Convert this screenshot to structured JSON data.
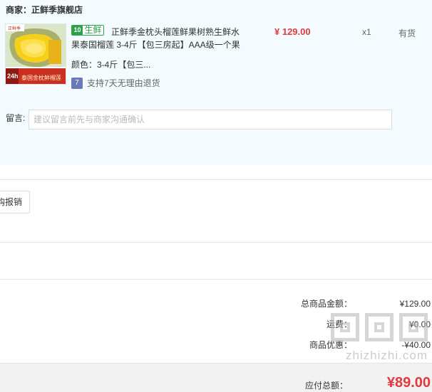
{
  "shop": {
    "label": "商家：",
    "name": "正鲜季旗舰店"
  },
  "product": {
    "fresh_tag": {
      "icon": "store-fresh-icon",
      "text": "生鲜",
      "color": "#2ca34a"
    },
    "title": "正鲜季金枕头榴莲鲜果树熟生鲜水果泰国榴莲 3-4斤【包三房起】AAA级一个果",
    "image_caption": "泰国金枕鲜榴莲",
    "image_badge": "24h",
    "price": "¥ 129.00",
    "quantity": "x1",
    "stock": "有货",
    "color_label": "颜色：",
    "color_value": "3-4斤【包三...",
    "return_badge": "7",
    "return_policy": "支持7天无理由退货"
  },
  "remark": {
    "label": "留言:",
    "placeholder": "建议留言前先与商家沟通确认"
  },
  "invoice": {
    "button_label": "购报销"
  },
  "summary": {
    "rows": [
      {
        "label": "总商品金额：",
        "value": "¥129.00"
      },
      {
        "label": "运费：",
        "value": "¥0.00"
      },
      {
        "label": "商品优惠：",
        "value": "-¥40.00"
      }
    ],
    "payable_label": "应付总额：",
    "payable_value": "¥89.00"
  },
  "watermark": {
    "text": "zhizhizhi.com"
  },
  "colors": {
    "panel_bg": "#f3fbfe",
    "price_red": "#e4393c",
    "fresh_green": "#2ca34a",
    "return_blue": "#6a7ab6"
  }
}
